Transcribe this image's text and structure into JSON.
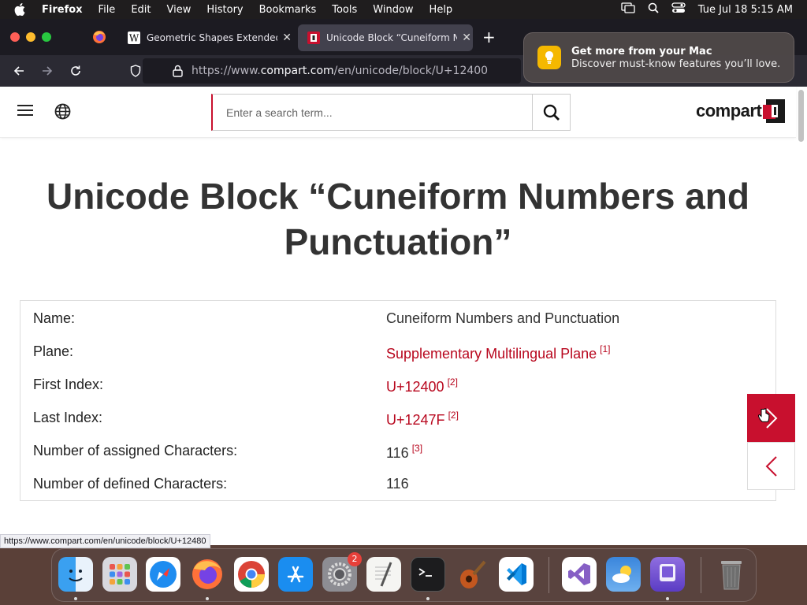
{
  "menubar": {
    "app": "Firefox",
    "items": [
      "File",
      "Edit",
      "View",
      "History",
      "Bookmarks",
      "Tools",
      "Window",
      "Help"
    ],
    "clock": "Tue Jul 18  5:15 AM"
  },
  "browser": {
    "tabs": [
      {
        "title": "Geometric Shapes Extended - W"
      },
      {
        "title": "Unicode Block “Cuneiform Num"
      }
    ],
    "url_prefix": "https://www.",
    "url_domain": "compart.com",
    "url_path": "/en/unicode/block/U+12400",
    "status_url": "https://www.compart.com/en/unicode/block/U+12480"
  },
  "notification": {
    "title": "Get more from your Mac",
    "body": "Discover must-know features you’ll love."
  },
  "site": {
    "search_placeholder": "Enter a search term...",
    "logo_text": "compart",
    "page_title": "Unicode Block “Cuneiform Numbers and Punctuation”",
    "rows": [
      {
        "key": "Name:",
        "value": "Cuneiform Numbers and Punctuation",
        "ref": ""
      },
      {
        "key": "Plane:",
        "value": "Supplementary Multilingual Plane",
        "ref": "[1]"
      },
      {
        "key": "First Index:",
        "value": "U+12400",
        "ref": "[2]"
      },
      {
        "key": "Last Index:",
        "value": "U+1247F",
        "ref": "[2]"
      },
      {
        "key": "Number of assigned Characters:",
        "value": "116",
        "ref": "[3]"
      },
      {
        "key": "Number of defined Characters:",
        "value": "116",
        "ref": ""
      }
    ]
  },
  "colors": {
    "accent": "#c8102e",
    "link": "#b8071e"
  },
  "dock": {
    "apps": [
      "finder-icon",
      "launchpad-icon",
      "safari-icon",
      "firefox-icon",
      "chrome-icon",
      "app-store-icon",
      "system-settings-icon",
      "textedit-icon",
      "terminal-icon",
      "instruments-icon",
      "vscode-icon",
      "visual-studio-icon",
      "weather-icon",
      "simulator-icon",
      "trash-icon"
    ],
    "settings_badge": "2"
  }
}
